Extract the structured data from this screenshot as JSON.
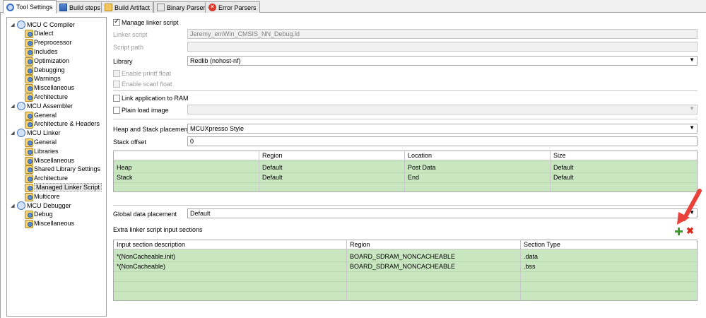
{
  "tabs": [
    {
      "label": "Tool Settings",
      "icon": "tool-settings-icon"
    },
    {
      "label": "Build steps",
      "icon": "build-steps-icon"
    },
    {
      "label": "Build Artifact",
      "icon": "build-artifact-icon"
    },
    {
      "label": "Binary Parsers",
      "icon": "binary-parsers-icon"
    },
    {
      "label": "Error Parsers",
      "icon": "error-parsers-icon"
    }
  ],
  "tree": [
    {
      "label": "MCU C Compiler",
      "level": 0,
      "expanded": true
    },
    {
      "label": "Dialect",
      "level": 1
    },
    {
      "label": "Preprocessor",
      "level": 1
    },
    {
      "label": "Includes",
      "level": 1
    },
    {
      "label": "Optimization",
      "level": 1
    },
    {
      "label": "Debugging",
      "level": 1
    },
    {
      "label": "Warnings",
      "level": 1
    },
    {
      "label": "Miscellaneous",
      "level": 1
    },
    {
      "label": "Architecture",
      "level": 1
    },
    {
      "label": "MCU Assembler",
      "level": 0,
      "expanded": true
    },
    {
      "label": "General",
      "level": 1
    },
    {
      "label": "Architecture & Headers",
      "level": 1
    },
    {
      "label": "MCU Linker",
      "level": 0,
      "expanded": true
    },
    {
      "label": "General",
      "level": 1
    },
    {
      "label": "Libraries",
      "level": 1
    },
    {
      "label": "Miscellaneous",
      "level": 1
    },
    {
      "label": "Shared Library Settings",
      "level": 1
    },
    {
      "label": "Architecture",
      "level": 1
    },
    {
      "label": "Managed Linker Script",
      "level": 1,
      "selected": true
    },
    {
      "label": "Multicore",
      "level": 1
    },
    {
      "label": "MCU Debugger",
      "level": 0,
      "expanded": true
    },
    {
      "label": "Debug",
      "level": 1
    },
    {
      "label": "Miscellaneous",
      "level": 1
    }
  ],
  "settings": {
    "manage_linker_script": {
      "label": "Manage linker script",
      "checked": true
    },
    "linker_script": {
      "label": "Linker script",
      "value": "Jeremy_emWin_CMSIS_NN_Debug.ld"
    },
    "script_path": {
      "label": "Script path",
      "value": ""
    },
    "library": {
      "label": "Library",
      "value": "Redlib (nohost-nf)"
    },
    "enable_printf_float": {
      "label": "Enable printf float",
      "checked": false
    },
    "enable_scanf_float": {
      "label": "Enable scanf float",
      "checked": false
    },
    "link_to_ram": {
      "label": "Link application to RAM",
      "checked": false
    },
    "plain_load_image": {
      "label": "Plain load image",
      "checked": false,
      "value": ""
    },
    "heap_stack_placement": {
      "label": "Heap and Stack placement",
      "value": "MCUXpresso Style"
    },
    "stack_offset": {
      "label": "Stack offset",
      "value": "0"
    },
    "global_data_placement": {
      "label": "Global data placement",
      "value": "Default"
    },
    "extra_sections_label": "Extra linker script input sections"
  },
  "heap_table": {
    "columns": [
      "",
      "Region",
      "Location",
      "Size"
    ],
    "rows": [
      [
        "Heap",
        "Default",
        "Post Data",
        "Default"
      ],
      [
        "Stack",
        "Default",
        "End",
        "Default"
      ]
    ]
  },
  "sections_table": {
    "columns": [
      "Input section description",
      "Region",
      "Section Type"
    ],
    "rows": [
      [
        "*(NonCacheable.init)",
        "BOARD_SDRAM_NONCACHEABLE",
        ".data"
      ],
      [
        "*(NonCacheable)",
        "BOARD_SDRAM_NONCACHEABLE",
        ".bss"
      ]
    ]
  },
  "actions": {
    "add_icon": "add-icon",
    "remove_icon": "remove-icon"
  },
  "colors": {
    "table_green": "#c8e6c0",
    "annotation_arrow": "#e8423b",
    "add_green": "#3f9c2c",
    "remove_red": "#d62a1e"
  }
}
